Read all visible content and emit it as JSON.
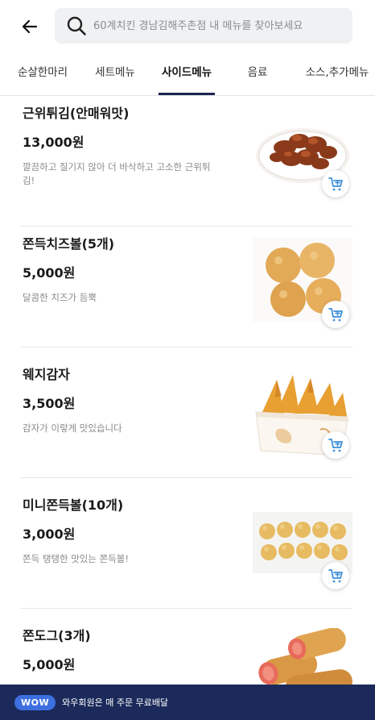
{
  "search": {
    "placeholder": "60계치킨 경남김해주촌점 내 메뉴를 찾아보세요"
  },
  "tabs": [
    {
      "label": "순살한마리"
    },
    {
      "label": "세트메뉴"
    },
    {
      "label": "사이드메뉴",
      "active": true
    },
    {
      "label": "음료"
    },
    {
      "label": "소스,추가메뉴"
    }
  ],
  "menu_items": [
    {
      "name": "근위튀김(안매워맛)",
      "price": "13,000원",
      "description": "깔끔하고 질기지 않아 더 바삭하고 고소한 근위튀김!",
      "image": "fried-gizzard-image"
    },
    {
      "name": "쫀득치즈볼(5개)",
      "price": "5,000원",
      "description": "달콤한 치즈가 듬뿍",
      "image": "cheese-ball-image"
    },
    {
      "name": "웨지감자",
      "price": "3,500원",
      "description": "감자가 이렇게 맛있습니다",
      "image": "wedge-potato-image"
    },
    {
      "name": "미니쫀득볼(10개)",
      "price": "3,000원",
      "description": "쫀득 탱탱한 맛있는 쫀득볼!",
      "image": "mini-ball-image"
    },
    {
      "name": "쫀도그(3개)",
      "price": "5,000원",
      "description": "",
      "image": "corn-dog-image"
    }
  ],
  "icons": {
    "back": "arrow-left-icon",
    "search": "search-icon",
    "cart": "add-to-cart-icon"
  },
  "banner": {
    "badge": "WOW",
    "text": "와우회원은 매 주문 무료배달"
  },
  "colors": {
    "accent": "#1b2550",
    "banner_bg": "#1b2a5a",
    "badge_bg": "#3d6fe0",
    "cart_icon": "#3d8fd9"
  }
}
